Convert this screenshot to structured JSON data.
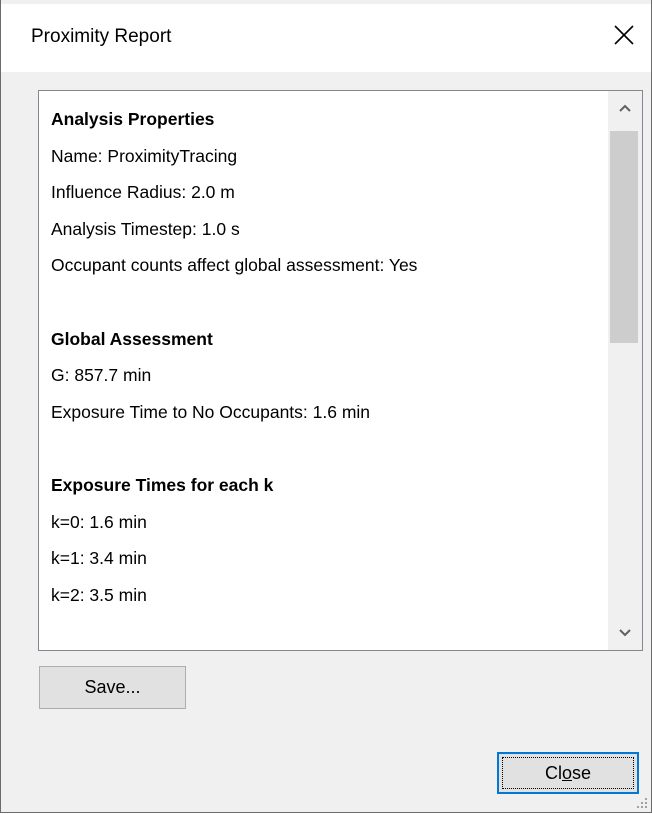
{
  "window": {
    "title": "Proximity Report"
  },
  "report": {
    "analysis_heading": "Analysis Properties",
    "name": "Name: ProximityTracing",
    "influence_radius": "Influence Radius: 2.0 m",
    "analysis_timestep": "Analysis Timestep: 1.0 s",
    "occupant_counts": "Occupant counts affect global assessment: Yes",
    "global_heading": "Global Assessment",
    "g_value": "G: 857.7 min",
    "exposure_no_occupants": "Exposure Time to No Occupants: 1.6 min",
    "exposure_heading": "Exposure Times for each k",
    "k_times": [
      "k=0: 1.6 min",
      "k=1: 3.4 min",
      "k=2: 3.5 min"
    ]
  },
  "buttons": {
    "save_label": "Save...",
    "close_label_pre": "Cl",
    "close_label_mnemonic": "o",
    "close_label_post": "se"
  },
  "icons": {
    "close": "close-x-icon",
    "scroll_up": "chevron-up-icon",
    "scroll_down": "chevron-down-icon",
    "size_grip": "resize-grip-icon"
  },
  "colors": {
    "window_bg": "#f0f0f0",
    "focus_accent": "#0078d7",
    "scroll_thumb": "#cdcdcd"
  }
}
